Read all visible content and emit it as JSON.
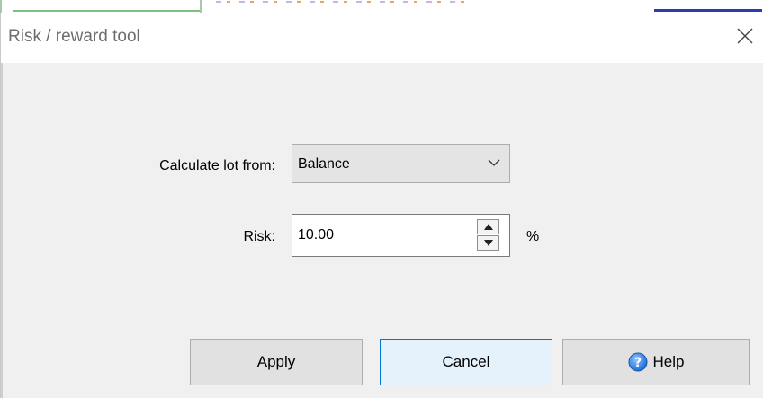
{
  "window": {
    "title": "Risk / reward tool",
    "close_icon": "close-icon"
  },
  "form": {
    "lot_label": "Calculate lot from:",
    "lot_selected": "Balance",
    "risk_label": "Risk:",
    "risk_value": "10.00",
    "risk_unit": "%"
  },
  "buttons": {
    "apply": "Apply",
    "cancel": "Cancel",
    "help": "Help",
    "help_icon": "question-circle-icon"
  },
  "colors": {
    "dialog_bg": "#f0f0f0",
    "focus_border": "#0078d7",
    "help_icon": "#1e6fd9"
  }
}
